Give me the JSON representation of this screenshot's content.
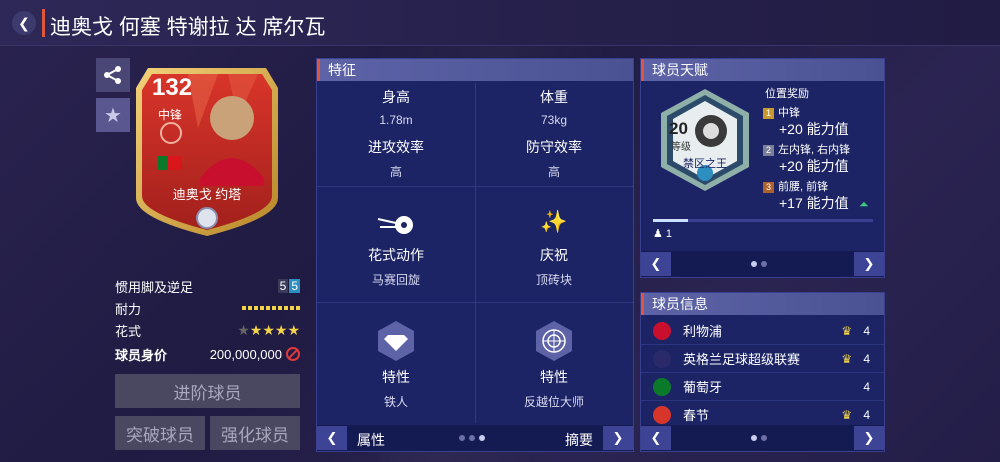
{
  "header": {
    "title": "迪奥戈 何塞 特谢拉 达 席尔瓦"
  },
  "card": {
    "rating": "132",
    "position": "中锋",
    "name": "迪奥戈 约塔"
  },
  "stats": {
    "weak_foot_label": "惯用脚及逆足",
    "weak_foot_left": "5",
    "weak_foot_right": "5",
    "stamina_label": "耐力",
    "stamina_level": 1.0,
    "skill_label": "花式",
    "skill_stars": 4,
    "price_label": "球员身价",
    "price_value": "200,000,000"
  },
  "buttons": {
    "upgrade": "进阶球员",
    "breakthrough": "突破球员",
    "enhance": "强化球员"
  },
  "traits_panel": {
    "title": "特征",
    "height_label": "身高",
    "height_value": "1.78m",
    "weight_label": "体重",
    "weight_value": "73kg",
    "attack_label": "进攻效率",
    "attack_value": "高",
    "defense_label": "防守效率",
    "defense_value": "高",
    "skill_move_label": "花式动作",
    "skill_move_value": "马赛回旋",
    "celebration_label": "庆祝",
    "celebration_value": "顶砖块",
    "trait1_label": "特性",
    "trait1_value": "铁人",
    "trait2_label": "特性",
    "trait2_value": "反越位大师",
    "footer_left": "属性",
    "footer_right": "摘要"
  },
  "talent_panel": {
    "title": "球员天赋",
    "level_num": "20",
    "level_label": "等级",
    "talent_name": "禁区之王",
    "bonus_title": "位置奖励",
    "bonuses": [
      {
        "rank": "1",
        "pos": "中锋",
        "val": "+20 能力值"
      },
      {
        "rank": "2",
        "pos": "左内锋, 右内锋",
        "val": "+20 能力值"
      },
      {
        "rank": "3",
        "pos": "前腰, 前锋",
        "val": "+17 能力值"
      }
    ],
    "count": "1",
    "progress": 0.16
  },
  "info_panel": {
    "title": "球员信息",
    "rows": [
      {
        "name": "利物浦",
        "num": "4"
      },
      {
        "name": "英格兰足球超级联赛",
        "num": "4"
      },
      {
        "name": "葡萄牙",
        "num": "4"
      },
      {
        "name": "春节",
        "num": "4"
      }
    ]
  },
  "colors": {
    "accent": "#e0563a",
    "panel": "#1c2466",
    "gold": "#f2d34a"
  }
}
